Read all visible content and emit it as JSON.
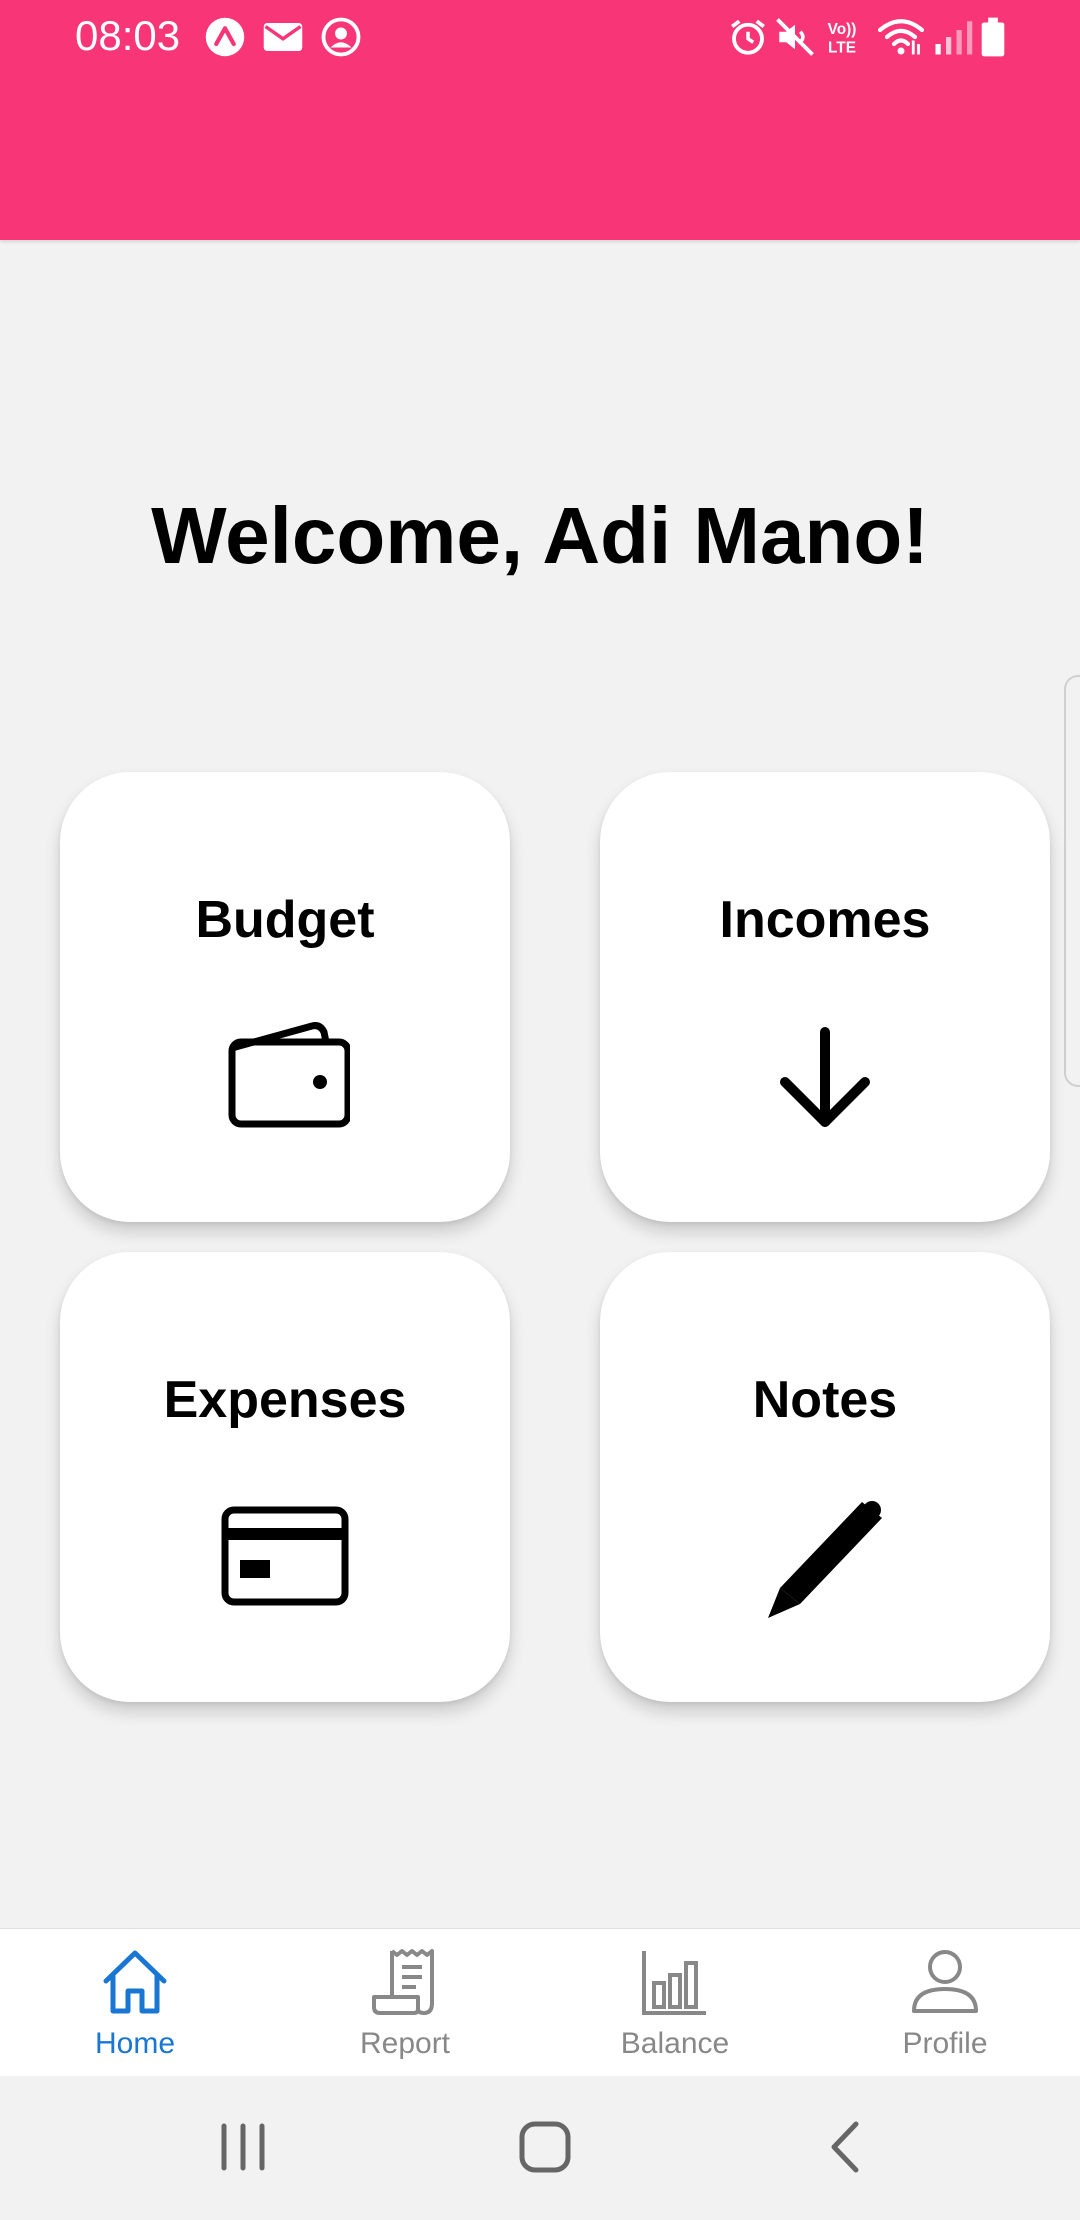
{
  "status_bar": {
    "time": "08:03",
    "volte_label_top": "Vo))",
    "volte_label_bottom": "LTE"
  },
  "welcome": {
    "title": "Welcome, Adi Mano!"
  },
  "cards": {
    "budget": {
      "label": "Budget",
      "icon": "wallet-icon"
    },
    "incomes": {
      "label": "Incomes",
      "icon": "arrow-down-icon"
    },
    "expenses": {
      "label": "Expenses",
      "icon": "credit-card-icon"
    },
    "notes": {
      "label": "Notes",
      "icon": "pencil-icon"
    }
  },
  "bottom_nav": {
    "items": [
      {
        "label": "Home",
        "icon": "home-icon",
        "active": true
      },
      {
        "label": "Report",
        "icon": "receipt-icon",
        "active": false
      },
      {
        "label": "Balance",
        "icon": "bar-chart-icon",
        "active": false
      },
      {
        "label": "Profile",
        "icon": "person-icon",
        "active": false
      }
    ]
  },
  "colors": {
    "header": "#f73577",
    "background": "#f2f2f2",
    "active_nav": "#1976d2",
    "inactive_nav": "#888888"
  }
}
